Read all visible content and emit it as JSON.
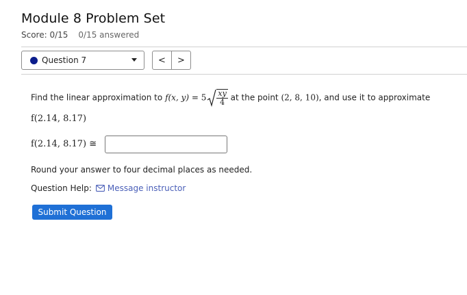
{
  "header": {
    "title": "Module 8 Problem Set",
    "score": "Score: 0/15",
    "answered": "0/15 answered"
  },
  "question_nav": {
    "selected": "Question 7",
    "prev_label": "<",
    "next_label": ">",
    "status_color": "#0b1d8c"
  },
  "problem": {
    "intro": "Find the linear approximation to",
    "func_lhs": "f(x, y)",
    "equals": "=",
    "coef": "5",
    "numerator": "xy",
    "denominator": "4",
    "at_text": "at the point",
    "point": "(2, 8, 10)",
    "tail": ", and use it to approximate",
    "target": "f(2.14, 8.17)"
  },
  "answer": {
    "label": "f(2.14, 8.17)",
    "approx_symbol": "≅",
    "value": ""
  },
  "instructions": "Round your answer to four decimal places as needed.",
  "help": {
    "label": "Question Help:",
    "link": "Message instructor"
  },
  "submit_label": "Submit Question",
  "colors": {
    "accent": "#1f70d6",
    "link": "#4a5fb8"
  }
}
